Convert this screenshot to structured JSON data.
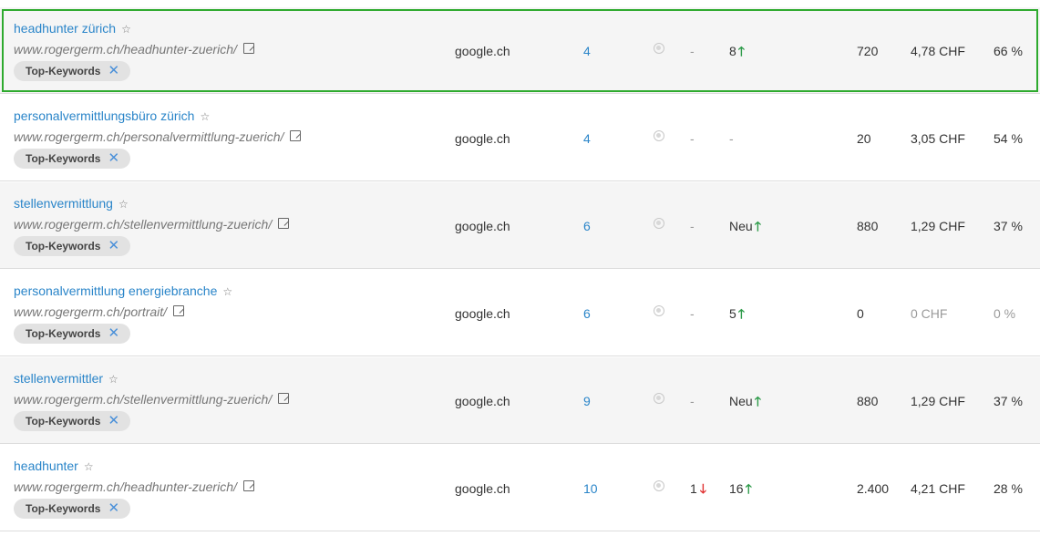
{
  "rows": [
    {
      "keyword": "headhunter zürich",
      "url": "www.rogergerm.ch/headhunter-zuerich/",
      "tag": "Top-Keywords",
      "engine": "google.ch",
      "position": "4",
      "change": "-",
      "best": "8",
      "best_trend": "up",
      "volume": "720",
      "cpc": "4,78 CHF",
      "competition": "66 %",
      "selected": true
    },
    {
      "keyword": "personalvermittlungsbüro zürich",
      "url": "www.rogergerm.ch/personalvermittlung-zuerich/",
      "tag": "Top-Keywords",
      "engine": "google.ch",
      "position": "4",
      "change": "-",
      "best": "-",
      "best_trend": "",
      "volume": "20",
      "cpc": "3,05 CHF",
      "competition": "54 %",
      "selected": false
    },
    {
      "keyword": "stellenvermittlung",
      "url": "www.rogergerm.ch/stellenvermittlung-zuerich/",
      "tag": "Top-Keywords",
      "engine": "google.ch",
      "position": "6",
      "change": "-",
      "best": "Neu",
      "best_trend": "up",
      "volume": "880",
      "cpc": "1,29 CHF",
      "competition": "37 %",
      "selected": false
    },
    {
      "keyword": "personalvermittlung energiebranche",
      "url": "www.rogergerm.ch/portrait/",
      "tag": "Top-Keywords",
      "engine": "google.ch",
      "position": "6",
      "change": "-",
      "best": "5",
      "best_trend": "up",
      "volume": "0",
      "cpc": "0 CHF",
      "competition": "0 %",
      "selected": false
    },
    {
      "keyword": "stellenvermittler",
      "url": "www.rogergerm.ch/stellenvermittlung-zuerich/",
      "tag": "Top-Keywords",
      "engine": "google.ch",
      "position": "9",
      "change": "-",
      "best": "Neu",
      "best_trend": "up",
      "volume": "880",
      "cpc": "1,29 CHF",
      "competition": "37 %",
      "selected": false
    },
    {
      "keyword": "headhunter",
      "url": "www.rogergerm.ch/headhunter-zuerich/",
      "tag": "Top-Keywords",
      "engine": "google.ch",
      "position": "10",
      "change": "1",
      "change_trend": "down",
      "best": "16",
      "best_trend": "up",
      "volume": "2.400",
      "cpc": "4,21 CHF",
      "competition": "28 %",
      "selected": false
    }
  ],
  "icons": {
    "favorite": "star-icon",
    "external_link": "external-link-icon",
    "remove_tag": "close-icon",
    "index": "globe-icon",
    "trend_up": "arrow-up-icon",
    "trend_down": "arrow-down-icon"
  },
  "colors": {
    "link": "#2a85c9",
    "selected_outline": "#2eaa2e",
    "trend_up": "#2e9b4a",
    "trend_down": "#e03030"
  }
}
